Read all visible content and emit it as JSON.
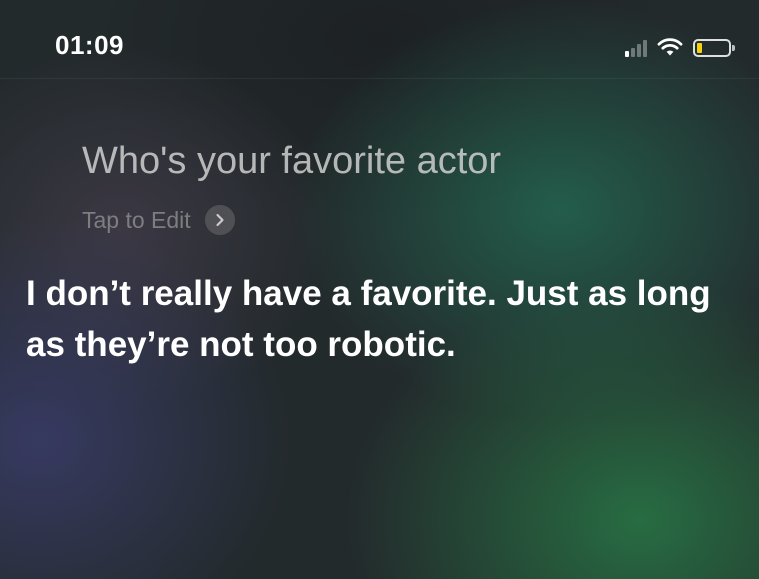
{
  "status_bar": {
    "time": "01:09",
    "signal_bars_active": 1,
    "signal_bars_total": 4,
    "battery_level": 0.15,
    "battery_color": "#f5d20d"
  },
  "siri": {
    "query": "Who's your favorite actor",
    "tap_to_edit_label": "Tap to Edit",
    "tap_to_edit_icon": "chevron-right-icon",
    "response": "I don’t really have a favorite. Just as long as they’re not too robotic."
  }
}
